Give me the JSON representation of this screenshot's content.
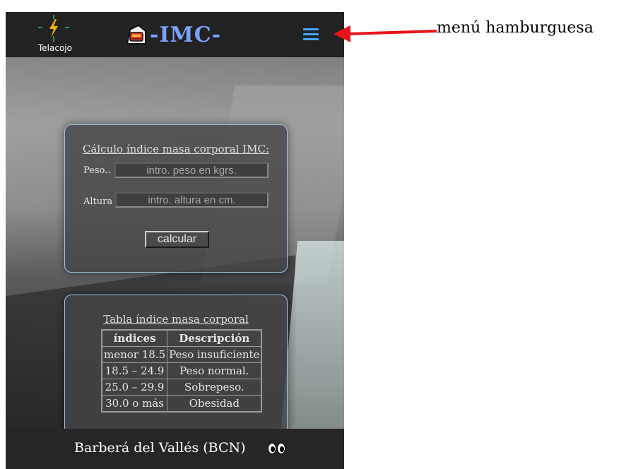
{
  "app": {
    "logo_label": "Telacojo",
    "title": "-IMC-"
  },
  "form": {
    "title": "Cálculo índice masa corporal IMC:",
    "weight_label": "Peso..",
    "weight_placeholder": "intro. peso en kgrs.",
    "height_label": "Altura",
    "height_placeholder": "intro. altura en cm.",
    "submit_label": "calcular"
  },
  "table": {
    "title": "Tabla índice masa corporal",
    "headers": [
      "índices",
      "Descripción"
    ],
    "rows": [
      [
        "menor 18.5",
        "Peso insuficiente"
      ],
      [
        "18.5 – 24.9",
        "Peso normal."
      ],
      [
        "25.0 – 29.9",
        "Sobrepeso."
      ],
      [
        "30.0 o más",
        "Obesidad"
      ]
    ]
  },
  "footer": {
    "location": "Barberá del Vallés (BCN)",
    "icon": "eyes-icon"
  },
  "annotation": {
    "label": "menú hamburguesa",
    "arrow_color": "#e8141a"
  },
  "colors": {
    "accent": "#3ea7ff",
    "brand_text": "#7aa2ff",
    "card_border": "#9ec3df"
  }
}
